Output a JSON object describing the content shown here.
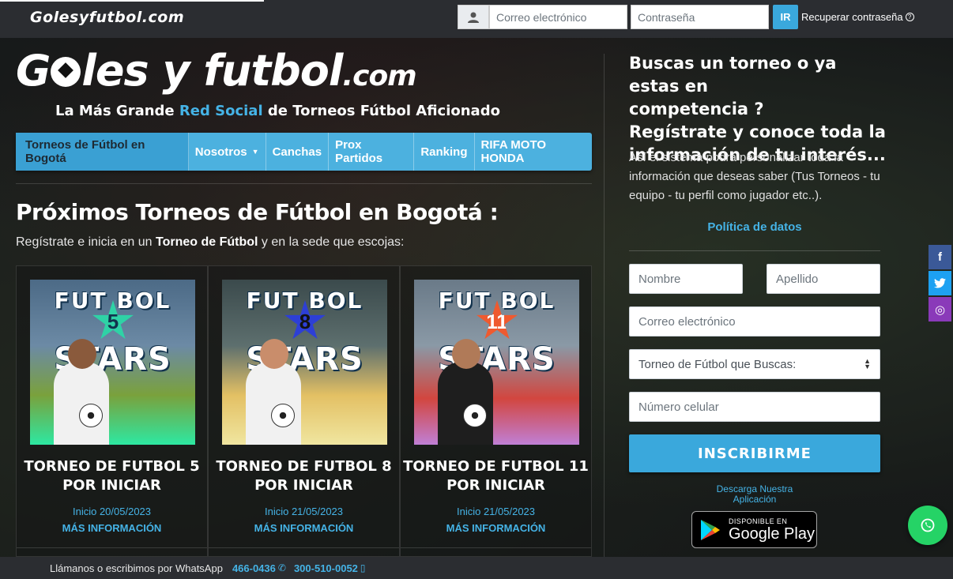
{
  "topbar": {
    "logo_text": "Golesyfutbol.com",
    "email_placeholder": "Correo electrónico",
    "password_placeholder": "Contraseña",
    "login_button": "IR",
    "recover_link": "Recuperar contraseña",
    "recover_icon": "?"
  },
  "brand": {
    "logo_part1": "G",
    "logo_part2": "les y futbol",
    "logo_part3": ".com",
    "tagline_pre": "La Más Grande ",
    "tagline_highlight": "Red Social",
    "tagline_post": " de Torneos Fútbol Aficionado"
  },
  "nav": {
    "items": [
      {
        "label": "Torneos de Fútbol en Bogotá",
        "active": true
      },
      {
        "label": "Nosotros",
        "dropdown": true
      },
      {
        "label": "Canchas"
      },
      {
        "label": "Prox Partidos"
      },
      {
        "label": "Ranking"
      },
      {
        "label": "RIFA MOTO HONDA"
      }
    ],
    "dropdown_caret": "▼"
  },
  "main": {
    "title": "Próximos Torneos de Fútbol en Bogotá :",
    "subtitle_pre": "Regístrate e inicia en un ",
    "subtitle_bold": "Torneo de Fútbol",
    "subtitle_post": " y en la sede que escojas:",
    "cards": [
      {
        "img_top": "FUT BOL",
        "img_number": "5",
        "img_bottom": "STARS",
        "title_line1": "TORNEO DE FUTBOL 5",
        "title_line2": "POR INICIAR",
        "date": "Inicio 20/05/2023",
        "more": "MÁS INFORMACIÓN",
        "star_color": "#2fd2a6"
      },
      {
        "img_top": "FUT BOL",
        "img_number": "8",
        "img_bottom": "STARS",
        "title_line1": "TORNEO DE FUTBOL 8",
        "title_line2": "POR INICIAR",
        "date": "Inicio 21/05/2023",
        "more": "MÁS INFORMACIÓN",
        "star_color": "#2d3fd6"
      },
      {
        "img_top": "FUT BOL",
        "img_number": "11",
        "img_bottom": "STARS",
        "title_line1": "TORNEO DE FUTBOL 11",
        "title_line2": "POR INICIAR",
        "date": "Inicio 21/05/2023",
        "more": "MÁS INFORMACIÓN",
        "star_color": "#ef5a2f"
      }
    ]
  },
  "signup": {
    "heading_line1": "Buscas un torneo o ya estas en",
    "heading_line2": "competencia ?",
    "heading_line3": "Regístrate y conoce toda la",
    "heading_line4": "información de tu interés...",
    "description": "Así el sistema podrá personalizar toda la información que deseas saber (Tus Torneos - tu equipo - tu perfil como jugador etc..).",
    "policy_link": "Política de datos",
    "name_placeholder": "Nombre",
    "lastname_placeholder": "Apellido",
    "email_placeholder": "Correo electrónico",
    "tournament_select": "Torneo de Fútbol que Buscas:",
    "phone_placeholder": "Número celular",
    "submit": "INSCRIBIRME",
    "download_text": "Descarga Nuestra Aplicación",
    "gplay_small": "DISPONIBLE EN",
    "gplay_big": "Google Play"
  },
  "social": {
    "facebook": "f",
    "twitter": "t",
    "instagram": "◎"
  },
  "footer": {
    "text": "Llámanos o escribimos por WhatsApp",
    "phone1": "466-0436",
    "phone2": "300-510-0052"
  },
  "colors": {
    "accent": "#45b3e6",
    "nav": "#4cb1df",
    "button": "#3aa8dc",
    "whatsapp": "#25d366"
  },
  "icons": {
    "user": "user-icon",
    "phone": "phone-icon",
    "mobile": "mobile-icon",
    "whatsapp": "whatsapp-icon",
    "facebook": "facebook-icon",
    "twitter": "twitter-icon",
    "instagram": "instagram-icon"
  }
}
